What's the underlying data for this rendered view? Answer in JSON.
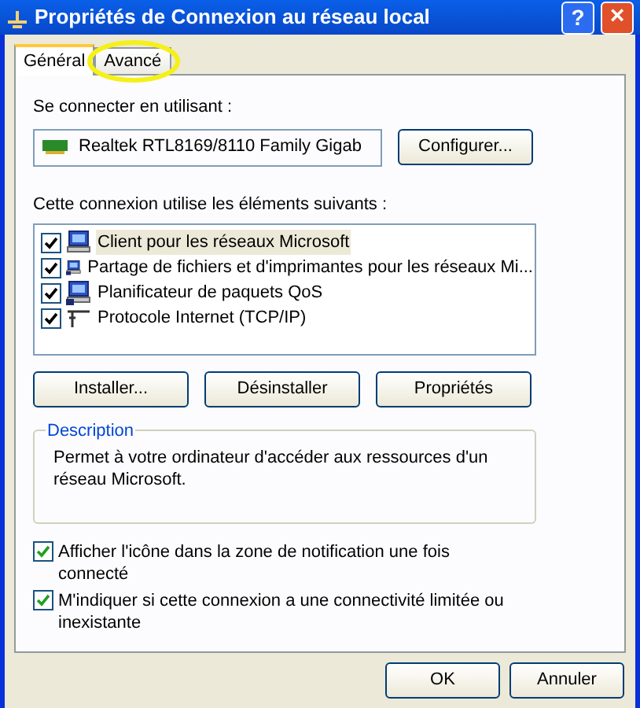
{
  "window": {
    "title": "Propriétés de Connexion au réseau local",
    "help": "?",
    "close": "×"
  },
  "tabs": [
    {
      "label": "Général",
      "selected": true,
      "highlighted": false
    },
    {
      "label": "Avancé",
      "selected": false,
      "highlighted": true
    }
  ],
  "connect_using": {
    "label": "Se connecter en utilisant :",
    "adapter": "Realtek RTL8169/8110 Family Gigab",
    "button": "Configurer..."
  },
  "components": {
    "label": "Cette connexion utilise les éléments suivants :",
    "items": [
      {
        "label": "Client pour les réseaux Microsoft",
        "checked": true,
        "selected": true,
        "kind": "computer"
      },
      {
        "label": "Partage de fichiers et d'imprimantes pour les réseaux Mi...",
        "checked": true,
        "selected": false,
        "kind": "service"
      },
      {
        "label": "Planificateur de paquets QoS",
        "checked": true,
        "selected": false,
        "kind": "service"
      },
      {
        "label": "Protocole Internet (TCP/IP)",
        "checked": true,
        "selected": false,
        "kind": "protocol"
      }
    ],
    "buttons": [
      "Installer...",
      "Désinstaller",
      "Propriétés"
    ]
  },
  "description": {
    "title": "Description",
    "text": "Permet à votre ordinateur d'accéder aux ressources d'un réseau Microsoft."
  },
  "options": [
    {
      "label": "Afficher l'icône dans la zone de notification une fois connecté",
      "checked": true
    },
    {
      "label": "M'indiquer si cette connexion a une connectivité limitée ou inexistante",
      "checked": true
    }
  ],
  "footer_buttons": [
    "OK",
    "Annuler"
  ]
}
